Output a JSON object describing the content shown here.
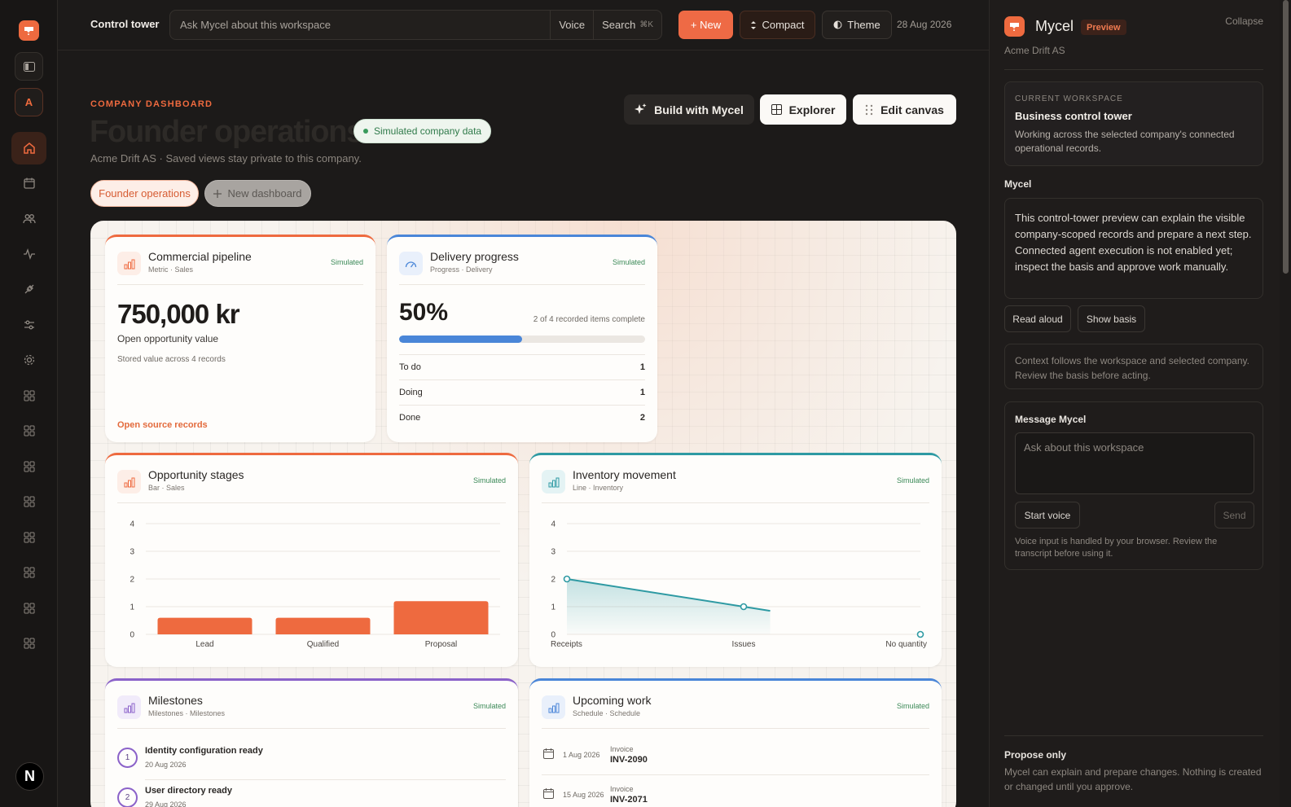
{
  "app": {
    "title": "Control tower",
    "search_placeholder": "Ask Mycel about this workspace",
    "voice_label": "Voice",
    "search_label": "Search",
    "search_shortcut": "⌘K",
    "new_label": "+ New",
    "compact_label": "Compact",
    "theme_label": "Theme",
    "date": "28 Aug 2026",
    "user_initial": "A",
    "footer_logo": "N",
    "accent": "#ee6a3f"
  },
  "rail": {
    "items": [
      "home-icon",
      "calendar-icon",
      "people-icon",
      "activity-icon",
      "plug-icon",
      "sliders-icon",
      "gear-icon",
      "grid-icon",
      "grid-icon",
      "grid-icon",
      "grid-icon",
      "grid-icon",
      "grid-icon",
      "grid-icon",
      "grid-icon"
    ]
  },
  "header": {
    "eyebrow": "COMPANY DASHBOARD",
    "title": "Founder operations",
    "badge": "Simulated company data",
    "subtitle": "Acme Drift AS · Saved views stay private to this company.",
    "build_label": "Build with Mycel",
    "explorer_label": "Explorer",
    "edit_label": "Edit canvas",
    "tabs": [
      {
        "label": "Founder operations"
      },
      {
        "label": "New dashboard"
      }
    ]
  },
  "cards": {
    "pipeline": {
      "title": "Commercial pipeline",
      "subtitle": "Metric · Sales",
      "badge": "Simulated",
      "value": "750,000 kr",
      "value_label": "Open opportunity value",
      "note": "Stored value across 4 records",
      "link": "Open source records"
    },
    "delivery": {
      "title": "Delivery progress",
      "subtitle": "Progress · Delivery",
      "badge": "Simulated",
      "percent": "50%",
      "progress": 0.5,
      "note": "2 of 4 recorded items complete",
      "rows": [
        {
          "label": "To do",
          "value": "1"
        },
        {
          "label": "Doing",
          "value": "1"
        },
        {
          "label": "Done",
          "value": "2"
        }
      ]
    },
    "stages": {
      "title": "Opportunity stages",
      "subtitle": "Bar · Sales",
      "badge": "Simulated"
    },
    "inventory": {
      "title": "Inventory movement",
      "subtitle": "Line · Inventory",
      "badge": "Simulated"
    },
    "milestones": {
      "title": "Milestones",
      "subtitle": "Milestones · Milestones",
      "badge": "Simulated",
      "items": [
        {
          "num": "1",
          "title": "Identity configuration ready",
          "date": "20 Aug 2026"
        },
        {
          "num": "2",
          "title": "User directory ready",
          "date": "29 Aug 2026"
        }
      ]
    },
    "work": {
      "title": "Upcoming work",
      "subtitle": "Schedule · Schedule",
      "badge": "Simulated",
      "items": [
        {
          "date": "1 Aug 2026",
          "kind": "Invoice",
          "name": "INV-2090"
        },
        {
          "date": "15 Aug 2026",
          "kind": "Invoice",
          "name": "INV-2071"
        }
      ]
    }
  },
  "chart_data": [
    {
      "type": "bar",
      "categories": [
        "Lead",
        "Qualified",
        "Proposal"
      ],
      "values": [
        0.6,
        0.6,
        1.2
      ],
      "yticks": [
        "0",
        "1",
        "2",
        "3",
        "4"
      ],
      "ylim": [
        0,
        4
      ],
      "color": "#ee6a3f",
      "grid": true
    },
    {
      "type": "line",
      "categories": [
        "Receipts",
        "Issues",
        "No quantity"
      ],
      "x": [
        0,
        1,
        2
      ],
      "values": [
        2,
        1,
        0
      ],
      "yticks": [
        "0",
        "1",
        "2",
        "3",
        "4"
      ],
      "ylim": [
        0,
        4
      ],
      "color": "#2e9aa3",
      "grid": true
    }
  ],
  "panel": {
    "name": "Mycel",
    "preview": "Preview",
    "collapse": "Collapse",
    "org": "Acme Drift AS",
    "ws_kicker": "CURRENT WORKSPACE",
    "ws_title": "Business control tower",
    "ws_desc": "Working across the selected company's connected operational records.",
    "section": "Mycel",
    "message": "This control-tower preview can explain the visible company-scoped records and prepare a next step. Connected agent execution is not enabled yet; inspect the basis and approve work manually.",
    "read_aloud": "Read aloud",
    "show_basis": "Show basis",
    "context": "Context follows the workspace and selected company. Review the basis before acting.",
    "compose_title": "Message Mycel",
    "compose_placeholder": "Ask about this workspace",
    "start_voice": "Start voice",
    "send": "Send",
    "voice_note": "Voice input is handled by your browser. Review the transcript before using it.",
    "propose_title": "Propose only",
    "propose_desc": "Mycel can explain and prepare changes. Nothing is created or changed until you approve."
  }
}
